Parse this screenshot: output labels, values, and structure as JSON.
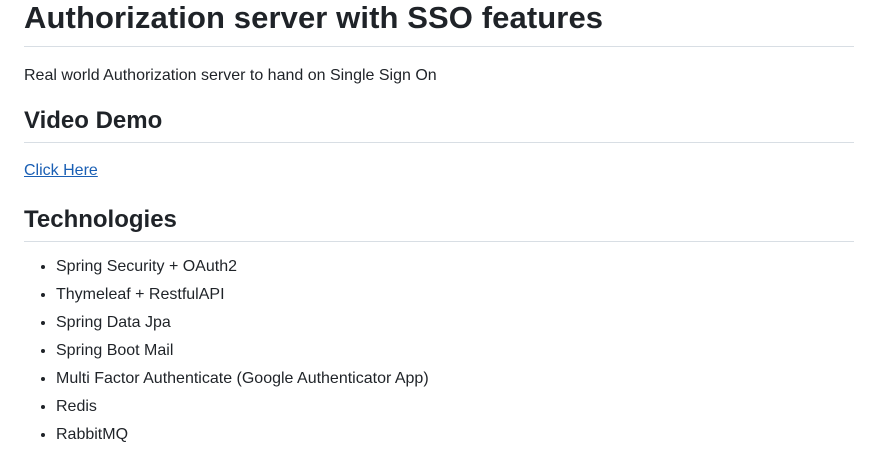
{
  "title": "Authorization server with SSO features",
  "subtitle": "Real world Authorization server to hand on Single Sign On",
  "video_demo": {
    "heading": "Video Demo",
    "link_label": "Click Here"
  },
  "technologies": {
    "heading": "Technologies",
    "items": [
      {
        "label": "Spring Security + OAuth2"
      },
      {
        "label": "Thymeleaf + RestfulAPI"
      },
      {
        "label": "Spring Data Jpa"
      },
      {
        "label": "Spring Boot Mail"
      },
      {
        "label": "Multi Factor Authenticate (Google Authenticator App)"
      },
      {
        "label": "Redis"
      },
      {
        "label": "RabbitMQ"
      }
    ]
  },
  "colors": {
    "text": "#1f2328",
    "link": "#1a5fb4",
    "divider": "#d8dee4",
    "background": "#ffffff"
  }
}
